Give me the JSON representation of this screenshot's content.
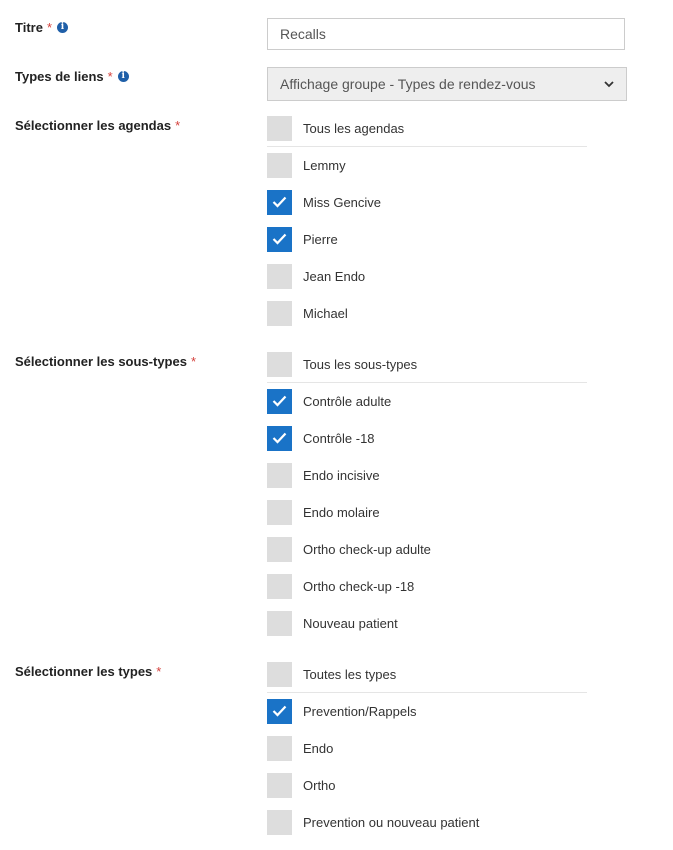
{
  "titre": {
    "label": "Titre",
    "required_mark": "*",
    "info_icon": "info-icon",
    "value": "Recalls"
  },
  "types_liens": {
    "label": "Types de liens",
    "required_mark": "*",
    "info_icon": "info-icon",
    "selected": "Affichage groupe - Types de rendez-vous"
  },
  "agendas": {
    "label": "Sélectionner les agendas",
    "required_mark": "*",
    "all": {
      "label": "Tous les agendas",
      "checked": false
    },
    "items": [
      {
        "label": "Lemmy",
        "checked": false
      },
      {
        "label": "Miss Gencive",
        "checked": true
      },
      {
        "label": "Pierre",
        "checked": true
      },
      {
        "label": "Jean Endo",
        "checked": false
      },
      {
        "label": "Michael",
        "checked": false
      }
    ]
  },
  "sous_types": {
    "label": "Sélectionner les sous-types",
    "required_mark": "*",
    "all": {
      "label": "Tous les sous-types",
      "checked": false
    },
    "items": [
      {
        "label": "Contrôle adulte",
        "checked": true
      },
      {
        "label": "Contrôle -18",
        "checked": true
      },
      {
        "label": "Endo incisive",
        "checked": false
      },
      {
        "label": "Endo molaire",
        "checked": false
      },
      {
        "label": "Ortho check-up adulte",
        "checked": false
      },
      {
        "label": "Ortho check-up -18",
        "checked": false
      },
      {
        "label": "Nouveau patient",
        "checked": false
      }
    ]
  },
  "types": {
    "label": "Sélectionner les types",
    "required_mark": "*",
    "all": {
      "label": "Toutes les types",
      "checked": false
    },
    "items": [
      {
        "label": "Prevention/Rappels",
        "checked": true
      },
      {
        "label": "Endo",
        "checked": false
      },
      {
        "label": "Ortho",
        "checked": false
      },
      {
        "label": "Prevention ou nouveau patient",
        "checked": false
      }
    ]
  },
  "colors": {
    "accent": "#1a73c7",
    "unchecked": "#dddddd",
    "required": "#d43f3a"
  }
}
